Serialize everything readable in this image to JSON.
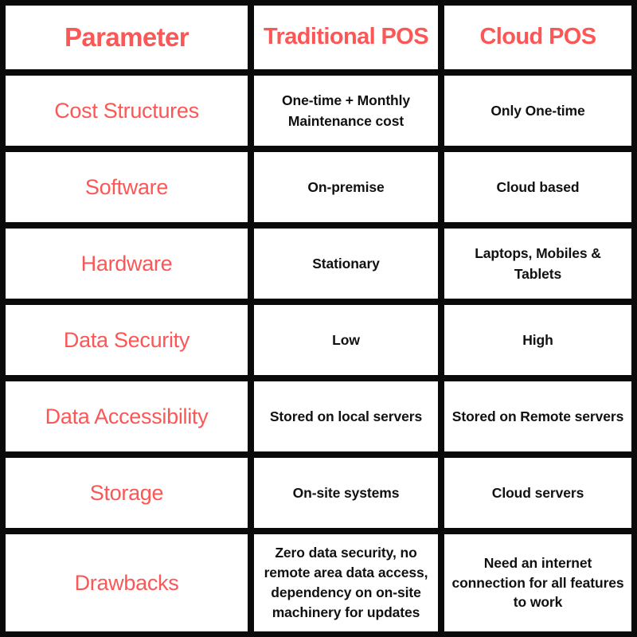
{
  "table": {
    "accent_color": "#fb5757",
    "text_color": "#111111",
    "border_color": "#0a0a0a",
    "background_color": "#ffffff",
    "headers": {
      "parameter": "Parameter",
      "traditional": "Traditional\nPOS",
      "cloud": "Cloud\nPOS"
    },
    "rows": [
      {
        "parameter": "Cost Structures",
        "traditional": "One-time + Monthly Maintenance cost",
        "cloud": "Only One-time"
      },
      {
        "parameter": "Software",
        "traditional": "On-premise",
        "cloud": "Cloud based"
      },
      {
        "parameter": "Hardware",
        "traditional": "Stationary",
        "cloud": "Laptops, Mobiles & Tablets"
      },
      {
        "parameter": "Data Security",
        "traditional": "Low",
        "cloud": "High"
      },
      {
        "parameter": "Data Accessibility",
        "traditional": "Stored on local servers",
        "cloud": "Stored on Remote servers"
      },
      {
        "parameter": "Storage",
        "traditional": "On-site systems",
        "cloud": "Cloud servers"
      },
      {
        "parameter": "Drawbacks",
        "traditional": "Zero data security, no remote area data access, dependency on on-site machinery for updates",
        "cloud": "Need an internet connection for all features to work"
      }
    ]
  }
}
